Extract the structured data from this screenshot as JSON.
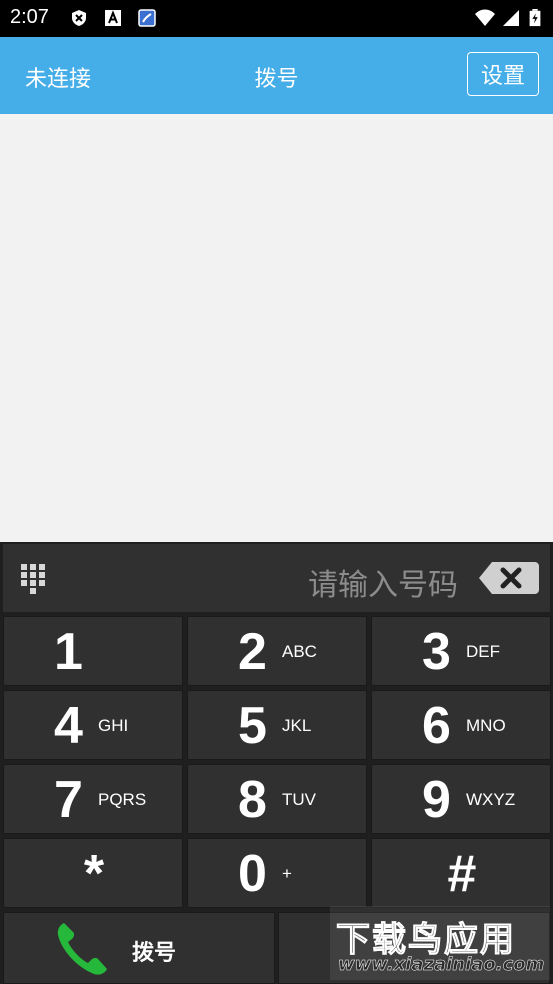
{
  "status_bar": {
    "time": "2:07",
    "icons": [
      "shield-x-icon",
      "font-a-icon",
      "app-icon",
      "wifi-icon",
      "signal-icon",
      "battery-icon"
    ]
  },
  "app_bar": {
    "left_status": "未连接",
    "title": "拨号",
    "settings_label": "设置",
    "color": "#45ade8"
  },
  "dialer": {
    "input_placeholder": "请输入号码",
    "keys": [
      {
        "digit": "1",
        "letters": ""
      },
      {
        "digit": "2",
        "letters": "ABC"
      },
      {
        "digit": "3",
        "letters": "DEF"
      },
      {
        "digit": "4",
        "letters": "GHI"
      },
      {
        "digit": "5",
        "letters": "JKL"
      },
      {
        "digit": "6",
        "letters": "MNO"
      },
      {
        "digit": "7",
        "letters": "PQRS"
      },
      {
        "digit": "8",
        "letters": "TUV"
      },
      {
        "digit": "9",
        "letters": "WXYZ"
      },
      {
        "digit": "*",
        "letters": ""
      },
      {
        "digit": "0",
        "letters": "+"
      },
      {
        "digit": "#",
        "letters": ""
      }
    ],
    "call_label": "拨号"
  },
  "watermark": {
    "line1": "下载鸟应用",
    "line2": "www.xiazainiao.com"
  }
}
